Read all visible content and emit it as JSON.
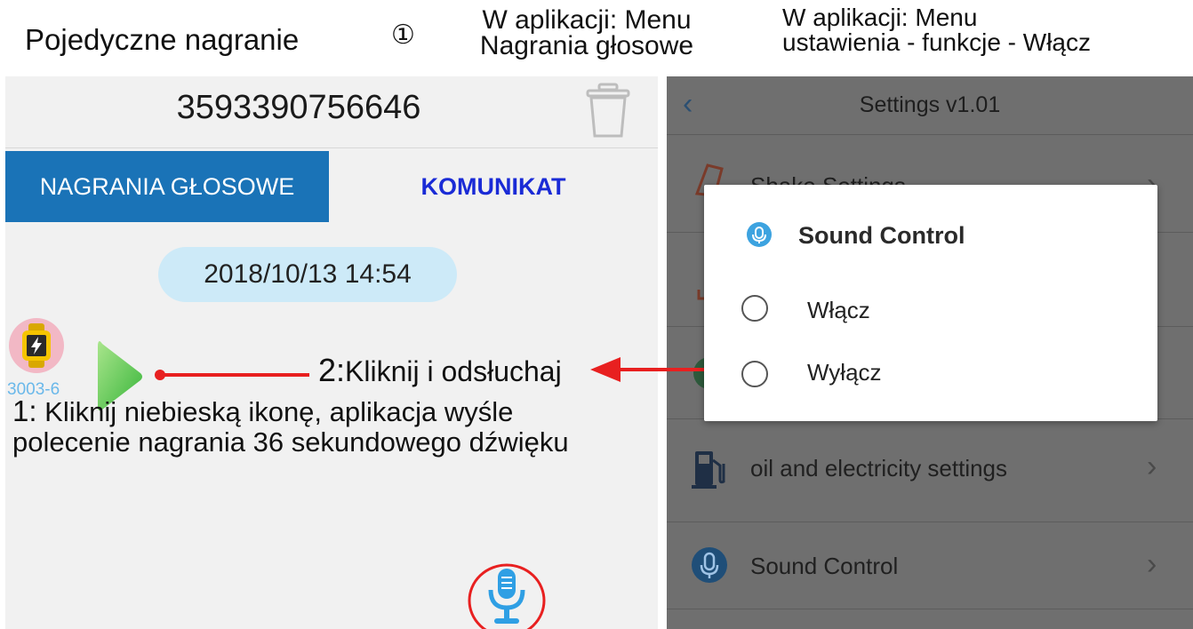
{
  "annotations": {
    "title": "Pojedyczne nagranie",
    "circle_marker": "①",
    "mid_line1": "W aplikacji: Menu",
    "mid_line2": "Nagrania głosowe",
    "right_line1": "W aplikacji: Menu",
    "right_line2": "ustawienia - funkcje - Włącz",
    "listen_number": "2:",
    "listen_text": "Kliknij i odsłuchaj",
    "bottom_number": "1:",
    "bottom_line1": " Kliknij niebieską ikonę, aplikacja wyśle",
    "bottom_line2": "polecenie nagrania 36 sekundowego dźwięku"
  },
  "left_app": {
    "phone_number": "3593390756646",
    "tabs": [
      "NAGRANIA GŁOSOWE",
      "KOMUNIKAT"
    ],
    "active_tab": "NAGRANIA GŁOSOWE",
    "message_date": "2018/10/13 14:54",
    "device_label": "3003-6",
    "icons": [
      "trash-icon",
      "watch-avatar-icon",
      "play-icon",
      "microphone-icon"
    ]
  },
  "right_app": {
    "title": "Settings v1.01",
    "items": [
      {
        "label": "Shake Settings",
        "icon": "shake-icon"
      },
      {
        "label": "oil and electricity settings",
        "icon": "fuel-pump-icon"
      },
      {
        "label": "Sound Control",
        "icon": "sound-control-icon"
      }
    ],
    "dialog": {
      "title": "Sound Control",
      "options": [
        "Włącz",
        "Wyłącz"
      ]
    }
  },
  "colors": {
    "tab_active_bg": "#1a73b7",
    "tab_inactive_text": "#1a2bd6",
    "date_pill_bg": "#cdeaf8",
    "annotation_red": "#e82020",
    "overlay_gray": "#6f6f6f"
  }
}
